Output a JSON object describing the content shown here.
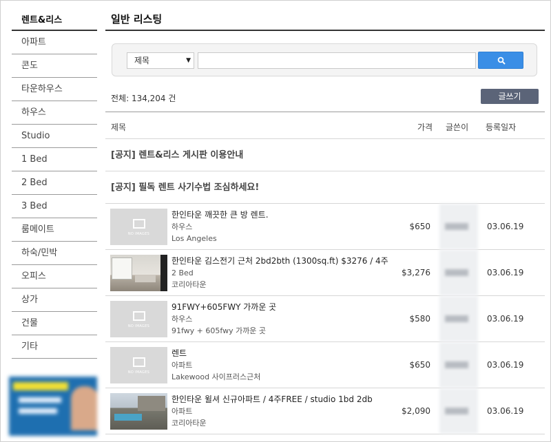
{
  "sidebar": {
    "title": "렌트&리스",
    "items": [
      "아파트",
      "콘도",
      "타운하우스",
      "하우스",
      "Studio",
      "1 Bed",
      "2 Bed",
      "3 Bed",
      "룸메이트",
      "하숙/민박",
      "오피스",
      "상가",
      "건물",
      "기타"
    ]
  },
  "main": {
    "title": "일반 리스팅",
    "search": {
      "select_value": "제목",
      "query": "",
      "button_icon": "search-icon"
    },
    "count": "전체: 134,204 건",
    "write_label": "글쓰기",
    "columns": {
      "title": "제목",
      "price": "가격",
      "writer": "글쓴이",
      "date": "등록일자"
    },
    "notices": [
      "[공지] 렌트&리스 게시판 이용안내",
      "[공지] 필독 렌트 사기수법 조심하세요!"
    ],
    "listings": [
      {
        "title": "한인타운 깨끗한 큰 방 렌트.",
        "type": "하우스",
        "location": "Los Angeles",
        "price": "$650",
        "date": "03.06.19",
        "thumb": "no-image",
        "no_image_text": "NO IMAGES"
      },
      {
        "title": "한인타운 김스전기 근처 2bd2bth (1300sq.ft) $3276 / 4주",
        "type": "2 Bed",
        "location": "코리아타운",
        "price": "$3,276",
        "date": "03.06.19",
        "thumb": "photo-interior"
      },
      {
        "title": "91FWY+605FWY 가까운 곳",
        "type": "하우스",
        "location": "91fwy + 605fwy 가까운 곳",
        "price": "$580",
        "date": "03.06.19",
        "thumb": "no-image",
        "no_image_text": "NO IMAGES"
      },
      {
        "title": "렌트",
        "type": "아파트",
        "location": "Lakewood 사이프러스근처",
        "price": "$650",
        "date": "03.06.19",
        "thumb": "no-image",
        "no_image_text": "NO IMAGES"
      },
      {
        "title": "한인타운 윌셔 신규아파트 / 4주FREE / studio 1bd 2db",
        "type": "아파트",
        "location": "코리아타운",
        "price": "$2,090",
        "date": "03.06.19",
        "thumb": "photo-exterior"
      }
    ]
  },
  "colors": {
    "search_button": "#3a8ee6",
    "write_button": "#5b6478",
    "border_dark": "#333333"
  }
}
